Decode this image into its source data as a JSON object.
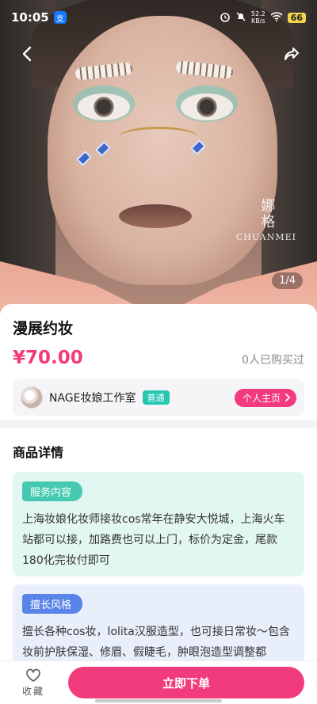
{
  "status_bar": {
    "time": "10:05",
    "pay_badge": "支",
    "speed_value": "52.2",
    "speed_unit": "KB/s",
    "battery": "66"
  },
  "gallery": {
    "page_indicator": "1/4",
    "watermark_cn": "娜格",
    "watermark_en": "CHUANMEI"
  },
  "product": {
    "title": "漫展约妆",
    "price": "¥70.00",
    "sold_text": "0人已购买过"
  },
  "shop": {
    "name": "NAGE妆娘工作室",
    "tag": "普通",
    "home_button": "个人主页"
  },
  "details": {
    "heading": "商品详情",
    "service_tag": "服务内容",
    "service_text": "上海妆娘化妆师接妆cos常年在静安大悦城，上海火车站都可以接，加路费也可以上门，标价为定金，尾款180化完妆付即可",
    "style_tag": "擅长风格",
    "style_text": "擅长各种cos妆，lolita汉服造型，也可接日常妆～包含妆前护肤保湿、修眉、假睫毛，肿眼泡造型调整都"
  },
  "bottom_bar": {
    "favorite_label": "收藏",
    "buy_label": "立即下单"
  },
  "colors": {
    "accent": "#f23b7c",
    "service_bg": "#e3f7f2",
    "style_bg": "#e9eefb"
  }
}
